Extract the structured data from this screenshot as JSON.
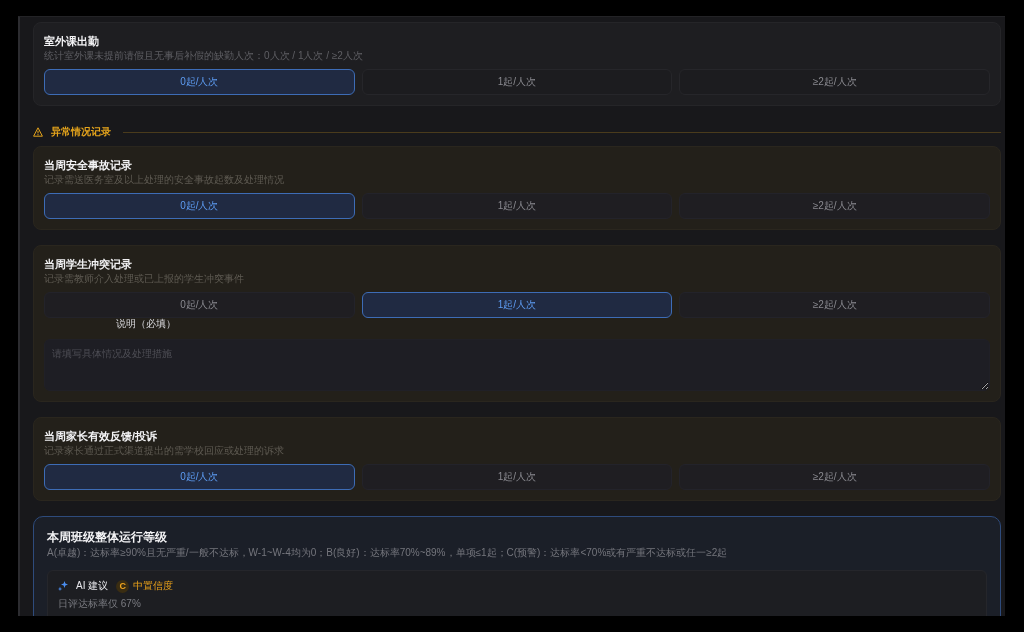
{
  "attendance": {
    "title": "室外课出勤",
    "description": "统计室外课未提前请假且无事后补假的缺勤人次：0人次 / 1人次 / ≥2人次",
    "options": [
      {
        "label": "0起/人次",
        "selected": true
      },
      {
        "label": "1起/人次",
        "selected": false
      },
      {
        "label": "≥2起/人次",
        "selected": false
      }
    ]
  },
  "anomaly_records": {
    "heading": "异常情况记录",
    "items": [
      {
        "title": "当周安全事故记录",
        "description": "记录需送医务室及以上处理的安全事故起数及处理情况",
        "options": [
          {
            "label": "0起/人次",
            "selected": true
          },
          {
            "label": "1起/人次",
            "selected": false
          },
          {
            "label": "≥2起/人次",
            "selected": false
          }
        ]
      },
      {
        "title": "当周学生冲突记录",
        "description": "记录需教师介入处理或已上报的学生冲突事件",
        "options": [
          {
            "label": "0起/人次",
            "selected": false
          },
          {
            "label": "1起/人次",
            "selected": true
          },
          {
            "label": "≥2起/人次",
            "selected": false
          }
        ],
        "note": {
          "label": "说明（必填）",
          "placeholder": "请填写具体情况及处理措施"
        }
      },
      {
        "title": "当周家长有效反馈/投诉",
        "description": "记录家长通过正式渠道提出的需学校回应或处理的诉求",
        "options": [
          {
            "label": "0起/人次",
            "selected": true
          },
          {
            "label": "1起/人次",
            "selected": false
          },
          {
            "label": "≥2起/人次",
            "selected": false
          }
        ]
      }
    ]
  },
  "weekly_grade": {
    "title": "本周班级整体运行等级",
    "description": "A(卓越)：达标率≥90%且无严重/一般不达标，W-1~W-4均为0；B(良好)：达标率70%~89%，单项≤1起；C(预警)：达标率<70%或有严重不达标或任一≥2起",
    "ai_suggestion": {
      "label": "AI 建议",
      "grade": "C",
      "confidence": "中置信度",
      "summary": "日评达标率仅 67%"
    }
  }
}
